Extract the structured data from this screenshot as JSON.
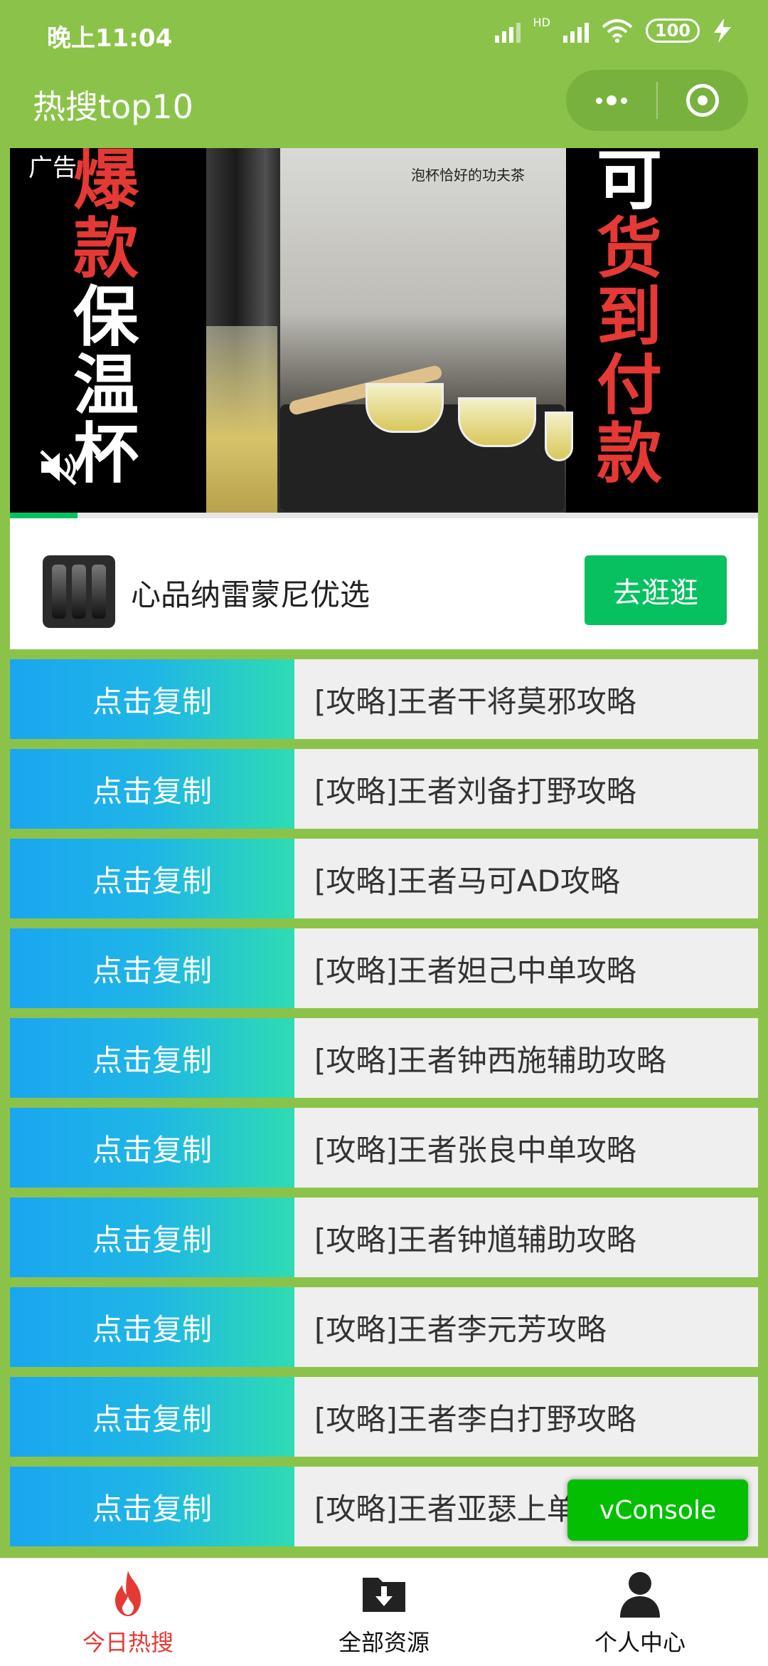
{
  "status_bar": {
    "time": "晚上11:04",
    "network": "HD",
    "battery": "100"
  },
  "title_bar": {
    "title": "热搜top10"
  },
  "ad": {
    "label": "广告",
    "left_text": [
      "爆",
      "款",
      "保",
      "温",
      "杯"
    ],
    "right_text": [
      "可",
      "货",
      "到",
      "付",
      "款"
    ],
    "tagline": "泡杯恰好的功夫茶",
    "progress": 0.09,
    "advertiser": "心品纳雷蒙尼优选",
    "cta": "去逛逛"
  },
  "list": {
    "copy_label": "点击复制",
    "items": [
      "[攻略]王者干将莫邪攻略",
      "[攻略]王者刘备打野攻略",
      "[攻略]王者马可AD攻略",
      "[攻略]王者妲己中单攻略",
      "[攻略]王者钟西施辅助攻略",
      "[攻略]王者张良中单攻略",
      "[攻略]王者钟馗辅助攻略",
      "[攻略]王者李元芳攻略",
      "[攻略]王者李白打野攻略",
      "[攻略]王者亚瑟上单"
    ]
  },
  "vconsole": {
    "label": "vConsole"
  },
  "tabbar": {
    "tabs": [
      {
        "label": "今日热搜",
        "icon": "flame-icon",
        "active": true
      },
      {
        "label": "全部资源",
        "icon": "download-folder-icon",
        "active": false
      },
      {
        "label": "个人中心",
        "icon": "person-icon",
        "active": false
      }
    ],
    "active_color": "#e53935"
  }
}
